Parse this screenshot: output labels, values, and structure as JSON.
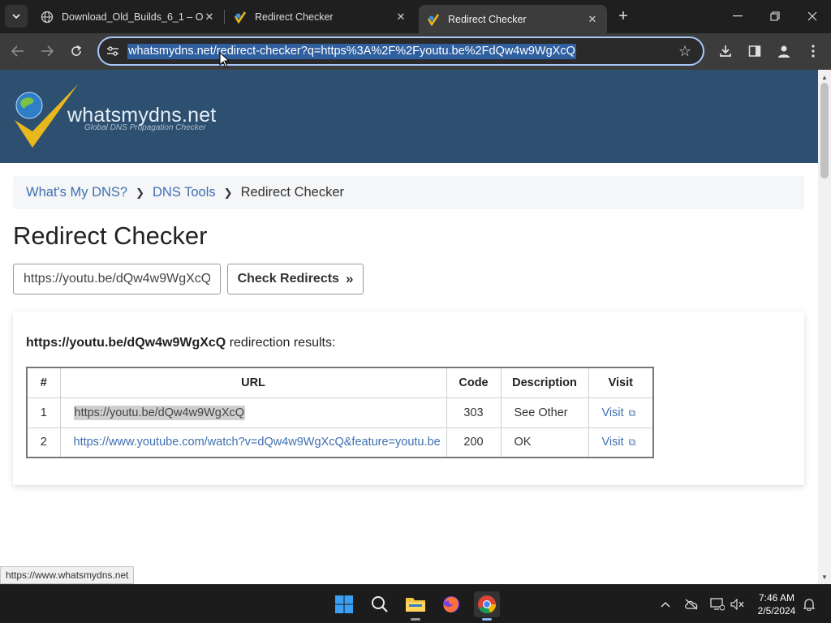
{
  "browser": {
    "tabs": [
      {
        "title": "Download_Old_Builds_6_1 – On",
        "active": false
      },
      {
        "title": "Redirect Checker",
        "active": false
      },
      {
        "title": "Redirect Checker",
        "active": true
      }
    ],
    "url": "whatsmydns.net/redirect-checker?q=https%3A%2F%2Fyoutu.be%2FdQw4w9WgXcQ"
  },
  "site": {
    "logo_text": "whatsmydns.net",
    "logo_tagline": "Global DNS Propagation Checker",
    "header_color": "#2e5070"
  },
  "breadcrumb": {
    "items": [
      "What's My DNS?",
      "DNS Tools"
    ],
    "current": "Redirect Checker"
  },
  "page": {
    "title": "Redirect Checker",
    "input_value": "https://youtu.be/dQw4w9WgXcQ",
    "check_button": "Check Redirects"
  },
  "results": {
    "query_url": "https://youtu.be/dQw4w9WgXcQ",
    "heading_suffix": "redirection results:",
    "columns": [
      "#",
      "URL",
      "Code",
      "Description",
      "Visit"
    ],
    "rows": [
      {
        "num": "1",
        "url": "https://youtu.be/dQw4w9WgXcQ",
        "code": "303",
        "description": "See Other",
        "visit": "Visit"
      },
      {
        "num": "2",
        "url": "https://www.youtube.com/watch?v=dQw4w9WgXcQ&feature=youtu.be",
        "code": "200",
        "description": "OK",
        "visit": "Visit"
      }
    ]
  },
  "status_tooltip": "https://www.whatsmydns.net",
  "taskbar": {
    "time": "7:46 AM",
    "date": "2/5/2024"
  }
}
